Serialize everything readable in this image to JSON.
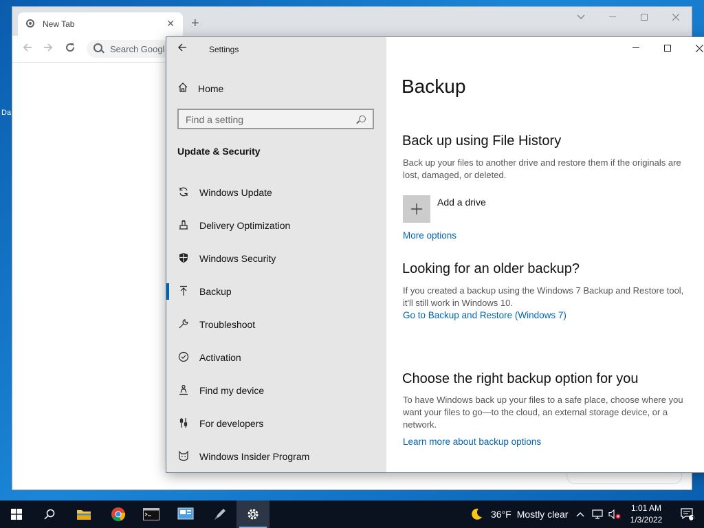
{
  "desktop": {
    "fragment_label": "Da"
  },
  "chrome": {
    "tab_title": "New Tab",
    "tab_close": "✕",
    "new_tab": "+",
    "omnibox_placeholder": "Search Googl"
  },
  "settings": {
    "window_title": "Settings",
    "home_label": "Home",
    "search_placeholder": "Find a setting",
    "section_title": "Update & Security",
    "nav_items": [
      {
        "label": "Windows Update",
        "icon": "refresh-icon"
      },
      {
        "label": "Delivery Optimization",
        "icon": "delivery-icon"
      },
      {
        "label": "Windows Security",
        "icon": "shield-icon"
      },
      {
        "label": "Backup",
        "icon": "upload-arrow-icon",
        "selected": true
      },
      {
        "label": "Troubleshoot",
        "icon": "wrench-icon"
      },
      {
        "label": "Activation",
        "icon": "check-circle-icon"
      },
      {
        "label": "Find my device",
        "icon": "person-locate-icon"
      },
      {
        "label": "For developers",
        "icon": "developer-tools-icon"
      },
      {
        "label": "Windows Insider Program",
        "icon": "insider-cat-icon"
      }
    ],
    "content": {
      "page_title": "Backup",
      "file_history": {
        "heading": "Back up using File History",
        "description": "Back up your files to another drive and restore them if the originals are lost, damaged, or deleted.",
        "add_drive_label": "Add a drive",
        "more_options": "More options"
      },
      "older_backup": {
        "heading": "Looking for an older backup?",
        "description": "If you created a backup using the Windows 7 Backup and Restore tool, it'll still work in Windows 10.",
        "link": "Go to Backup and Restore (Windows 7)"
      },
      "choose_option": {
        "heading": "Choose the right backup option for you",
        "description": "To have Windows back up your files to a safe place, choose where you want your files to go—to the cloud, an external storage device, or a network.",
        "link": "Learn more about backup options"
      }
    }
  },
  "taskbar": {
    "weather": {
      "temperature": "36°F",
      "condition": "Mostly clear"
    },
    "clock": {
      "time": "1:01 AM",
      "date": "1/3/2022"
    },
    "notification_count": "1",
    "accent_color": "#0063b1"
  }
}
